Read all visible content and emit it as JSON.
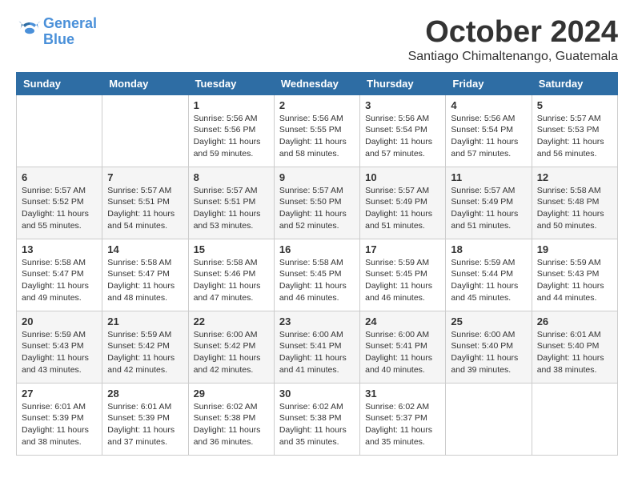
{
  "logo": {
    "line1": "General",
    "line2": "Blue"
  },
  "title": "October 2024",
  "location": "Santiago Chimaltenango, Guatemala",
  "days_of_week": [
    "Sunday",
    "Monday",
    "Tuesday",
    "Wednesday",
    "Thursday",
    "Friday",
    "Saturday"
  ],
  "weeks": [
    [
      {
        "day": "",
        "content": ""
      },
      {
        "day": "",
        "content": ""
      },
      {
        "day": "1",
        "content": "Sunrise: 5:56 AM\nSunset: 5:56 PM\nDaylight: 11 hours and 59 minutes."
      },
      {
        "day": "2",
        "content": "Sunrise: 5:56 AM\nSunset: 5:55 PM\nDaylight: 11 hours and 58 minutes."
      },
      {
        "day": "3",
        "content": "Sunrise: 5:56 AM\nSunset: 5:54 PM\nDaylight: 11 hours and 57 minutes."
      },
      {
        "day": "4",
        "content": "Sunrise: 5:56 AM\nSunset: 5:54 PM\nDaylight: 11 hours and 57 minutes."
      },
      {
        "day": "5",
        "content": "Sunrise: 5:57 AM\nSunset: 5:53 PM\nDaylight: 11 hours and 56 minutes."
      }
    ],
    [
      {
        "day": "6",
        "content": "Sunrise: 5:57 AM\nSunset: 5:52 PM\nDaylight: 11 hours and 55 minutes."
      },
      {
        "day": "7",
        "content": "Sunrise: 5:57 AM\nSunset: 5:51 PM\nDaylight: 11 hours and 54 minutes."
      },
      {
        "day": "8",
        "content": "Sunrise: 5:57 AM\nSunset: 5:51 PM\nDaylight: 11 hours and 53 minutes."
      },
      {
        "day": "9",
        "content": "Sunrise: 5:57 AM\nSunset: 5:50 PM\nDaylight: 11 hours and 52 minutes."
      },
      {
        "day": "10",
        "content": "Sunrise: 5:57 AM\nSunset: 5:49 PM\nDaylight: 11 hours and 51 minutes."
      },
      {
        "day": "11",
        "content": "Sunrise: 5:57 AM\nSunset: 5:49 PM\nDaylight: 11 hours and 51 minutes."
      },
      {
        "day": "12",
        "content": "Sunrise: 5:58 AM\nSunset: 5:48 PM\nDaylight: 11 hours and 50 minutes."
      }
    ],
    [
      {
        "day": "13",
        "content": "Sunrise: 5:58 AM\nSunset: 5:47 PM\nDaylight: 11 hours and 49 minutes."
      },
      {
        "day": "14",
        "content": "Sunrise: 5:58 AM\nSunset: 5:47 PM\nDaylight: 11 hours and 48 minutes."
      },
      {
        "day": "15",
        "content": "Sunrise: 5:58 AM\nSunset: 5:46 PM\nDaylight: 11 hours and 47 minutes."
      },
      {
        "day": "16",
        "content": "Sunrise: 5:58 AM\nSunset: 5:45 PM\nDaylight: 11 hours and 46 minutes."
      },
      {
        "day": "17",
        "content": "Sunrise: 5:59 AM\nSunset: 5:45 PM\nDaylight: 11 hours and 46 minutes."
      },
      {
        "day": "18",
        "content": "Sunrise: 5:59 AM\nSunset: 5:44 PM\nDaylight: 11 hours and 45 minutes."
      },
      {
        "day": "19",
        "content": "Sunrise: 5:59 AM\nSunset: 5:43 PM\nDaylight: 11 hours and 44 minutes."
      }
    ],
    [
      {
        "day": "20",
        "content": "Sunrise: 5:59 AM\nSunset: 5:43 PM\nDaylight: 11 hours and 43 minutes."
      },
      {
        "day": "21",
        "content": "Sunrise: 5:59 AM\nSunset: 5:42 PM\nDaylight: 11 hours and 42 minutes."
      },
      {
        "day": "22",
        "content": "Sunrise: 6:00 AM\nSunset: 5:42 PM\nDaylight: 11 hours and 42 minutes."
      },
      {
        "day": "23",
        "content": "Sunrise: 6:00 AM\nSunset: 5:41 PM\nDaylight: 11 hours and 41 minutes."
      },
      {
        "day": "24",
        "content": "Sunrise: 6:00 AM\nSunset: 5:41 PM\nDaylight: 11 hours and 40 minutes."
      },
      {
        "day": "25",
        "content": "Sunrise: 6:00 AM\nSunset: 5:40 PM\nDaylight: 11 hours and 39 minutes."
      },
      {
        "day": "26",
        "content": "Sunrise: 6:01 AM\nSunset: 5:40 PM\nDaylight: 11 hours and 38 minutes."
      }
    ],
    [
      {
        "day": "27",
        "content": "Sunrise: 6:01 AM\nSunset: 5:39 PM\nDaylight: 11 hours and 38 minutes."
      },
      {
        "day": "28",
        "content": "Sunrise: 6:01 AM\nSunset: 5:39 PM\nDaylight: 11 hours and 37 minutes."
      },
      {
        "day": "29",
        "content": "Sunrise: 6:02 AM\nSunset: 5:38 PM\nDaylight: 11 hours and 36 minutes."
      },
      {
        "day": "30",
        "content": "Sunrise: 6:02 AM\nSunset: 5:38 PM\nDaylight: 11 hours and 35 minutes."
      },
      {
        "day": "31",
        "content": "Sunrise: 6:02 AM\nSunset: 5:37 PM\nDaylight: 11 hours and 35 minutes."
      },
      {
        "day": "",
        "content": ""
      },
      {
        "day": "",
        "content": ""
      }
    ]
  ]
}
